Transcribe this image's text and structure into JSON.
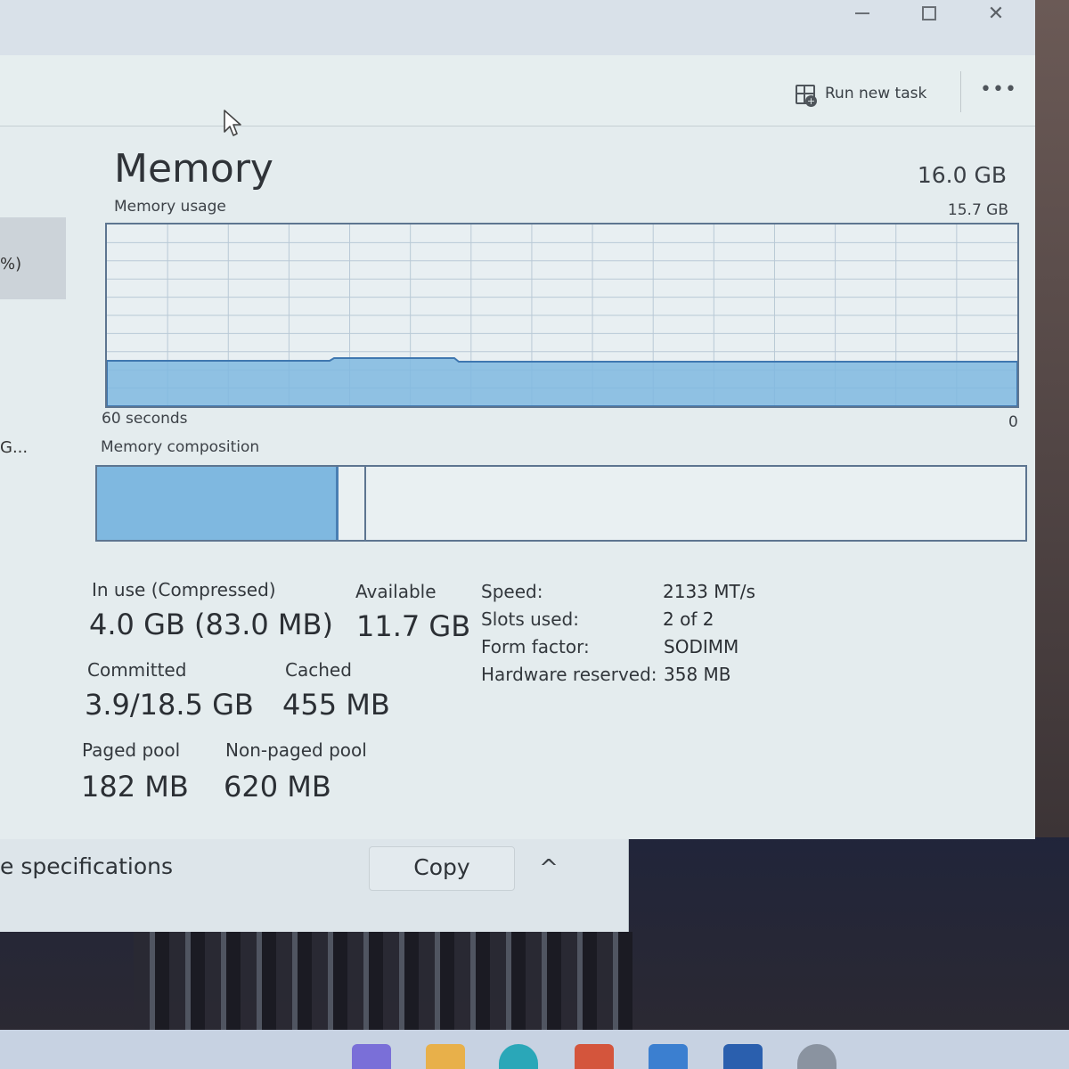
{
  "window": {
    "controls": {
      "minimize": "minimize-icon",
      "maximize": "maximize-icon",
      "close": "close-icon"
    },
    "close_glyph": "✕"
  },
  "toolbar": {
    "run_new_task": "Run new task",
    "more": "•••"
  },
  "sidebar": {
    "item_fragment_1": "%)",
    "item_fragment_2": "G..."
  },
  "memory": {
    "title": "Memory",
    "total": "16.0 GB",
    "usage_label": "Memory usage",
    "usage_max": "15.7 GB",
    "time_label": "60 seconds",
    "time_end": "0",
    "composition_label": "Memory composition",
    "graph_fill_fraction": 0.25,
    "composition": {
      "in_use_fraction": 0.26,
      "modified_fraction": 0.03
    },
    "colors": {
      "accent": "#7fb8e0",
      "border": "#5d7590"
    }
  },
  "stats": {
    "in_use_label": "In use (Compressed)",
    "in_use_value": "4.0 GB (83.0 MB)",
    "available_label": "Available",
    "available_value": "11.7 GB",
    "committed_label": "Committed",
    "committed_value": "3.9/18.5 GB",
    "cached_label": "Cached",
    "cached_value": "455 MB",
    "paged_pool_label": "Paged pool",
    "paged_pool_value": "182 MB",
    "non_paged_pool_label": "Non-paged pool",
    "non_paged_pool_value": "620 MB"
  },
  "specs": {
    "speed_label": "Speed:",
    "speed_value": "2133 MT/s",
    "slots_label": "Slots used:",
    "slots_value": "2 of 2",
    "form_label": "Form factor:",
    "form_value": "SODIMM",
    "reserved_label": "Hardware reserved:",
    "reserved_value": "358 MB"
  },
  "footer": {
    "specs_text": "e specifications",
    "copy_label": "Copy",
    "chevron": "^"
  }
}
